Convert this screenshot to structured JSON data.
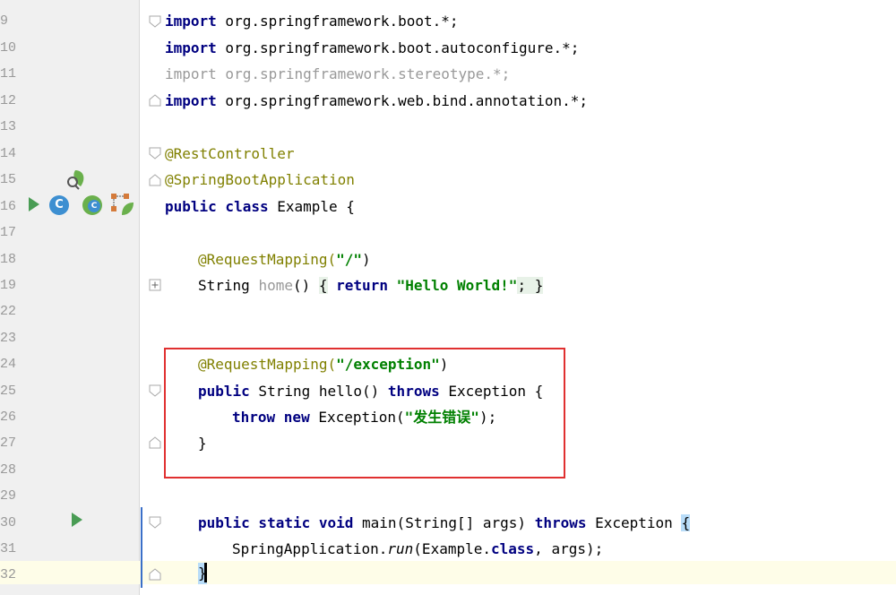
{
  "line_numbers": [
    "9",
    "10",
    "11",
    "12",
    "13",
    "14",
    "15",
    "16",
    "17",
    "18",
    "19",
    "22",
    "23",
    "24",
    "25",
    "26",
    "27",
    "28",
    "29",
    "30",
    "31",
    "32"
  ],
  "code": {
    "l9_kw": "import",
    "l9_rest": " org.springframework.boot.*;",
    "l10_kw": "import",
    "l10_rest": " org.springframework.boot.autoconfigure.*;",
    "l11": "import org.springframework.stereotype.*;",
    "l12_kw": "import",
    "l12_rest": " org.springframework.web.bind.annotation.*;",
    "l14": "@RestController",
    "l15": "@SpringBootApplication",
    "l16_kw": "public class",
    "l16_rest": " Example {",
    "l18_ann": "@RequestMapping(",
    "l18_str": "\"/\"",
    "l18_end": ")",
    "l19_a": "String ",
    "l19_home": "home",
    "l19_b": "() ",
    "l19_brace1": "{",
    "l19_kw": " return ",
    "l19_str": "\"Hello World!\"",
    "l19_semi": "; ",
    "l19_brace2": "}",
    "l24_ann": "@RequestMapping(",
    "l24_str": "\"/exception\"",
    "l24_end": ")",
    "l25_kw1": "public",
    "l25_a": " String hello() ",
    "l25_kw2": "throws",
    "l25_b": " Exception {",
    "l26_kw": "throw new",
    "l26_a": " Exception(",
    "l26_str": "\"发生错误\"",
    "l26_b": ");",
    "l27": "}",
    "l30_kw": "public static void",
    "l30_a": " main(String[] args) ",
    "l30_kw2": "throws",
    "l30_b": " Exception ",
    "l30_brace": "{",
    "l31_a": "SpringApplication.",
    "l31_run": "run",
    "l31_b": "(Example.",
    "l31_kw": "class",
    "l31_c": ", args);",
    "l32": "}"
  },
  "gutter_icons": {
    "bean_c1": "C",
    "bean_c2": "C"
  }
}
